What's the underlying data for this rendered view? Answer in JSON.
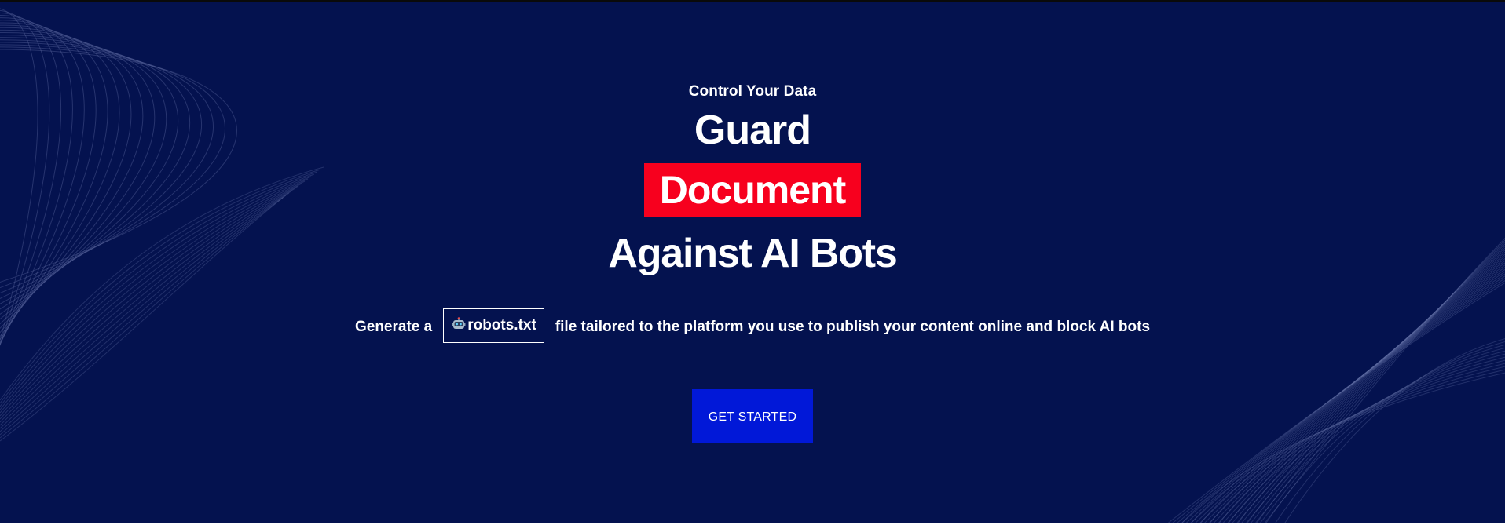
{
  "hero": {
    "eyebrow": "Control Your Data",
    "line1": "Guard",
    "highlight_word": "Document",
    "line3": "Against AI Bots",
    "sub_prefix": "Generate a",
    "chip_label": "robots.txt",
    "chip_icon": "robot-icon",
    "sub_suffix": "file tailored to the platform you use to publish your content online and block AI bots",
    "cta_label": "GET STARTED"
  },
  "colors": {
    "background": "#04124f",
    "highlight": "#f7001e",
    "cta": "#0118d8",
    "text": "#ffffff"
  }
}
